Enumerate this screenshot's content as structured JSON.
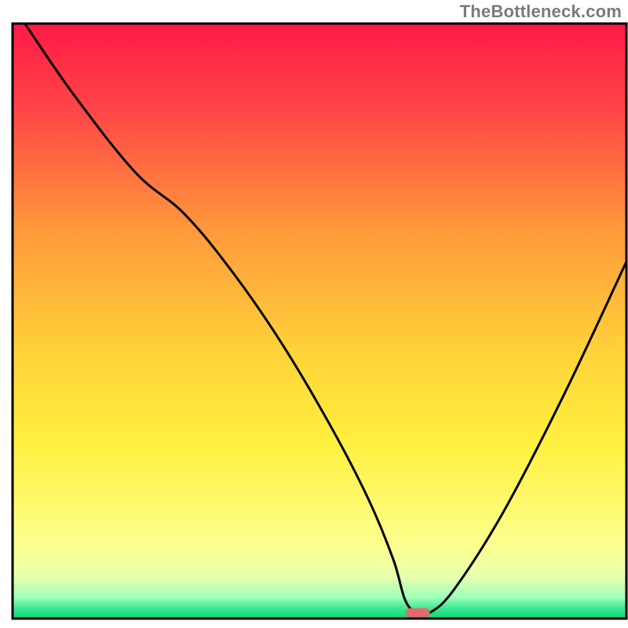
{
  "watermark": "TheBottleneck.com",
  "chart_data": {
    "type": "line",
    "title": "",
    "xlabel": "",
    "ylabel": "",
    "xlim": [
      0,
      100
    ],
    "ylim": [
      0,
      100
    ],
    "grid": false,
    "legend": false,
    "background_gradient": {
      "stops": [
        {
          "offset": 0.0,
          "color": "#ff1a47"
        },
        {
          "offset": 0.15,
          "color": "#ff4747"
        },
        {
          "offset": 0.35,
          "color": "#ff9a3b"
        },
        {
          "offset": 0.55,
          "color": "#ffd23a"
        },
        {
          "offset": 0.7,
          "color": "#ffef3e"
        },
        {
          "offset": 0.8,
          "color": "#fff96a"
        },
        {
          "offset": 0.88,
          "color": "#fbff8f"
        },
        {
          "offset": 0.93,
          "color": "#e7ffae"
        },
        {
          "offset": 0.965,
          "color": "#9cffb9"
        },
        {
          "offset": 0.985,
          "color": "#30e78a"
        },
        {
          "offset": 1.0,
          "color": "#14d37a"
        }
      ]
    },
    "series": [
      {
        "name": "bottleneck-curve",
        "color": "#000000",
        "x": [
          2,
          10,
          20,
          28,
          36,
          44,
          52,
          58,
          62,
          64,
          66,
          68,
          72,
          80,
          90,
          100
        ],
        "values": [
          100,
          88,
          75,
          68,
          58,
          46,
          32,
          20,
          10,
          3,
          1,
          1,
          5,
          18,
          38,
          60
        ]
      }
    ],
    "marker": {
      "name": "minimum-marker",
      "x": 66,
      "y": 1,
      "color": "#e26b6b",
      "width": 4,
      "height": 1.5
    },
    "plot_border": {
      "color": "#000000",
      "width": 3
    }
  }
}
